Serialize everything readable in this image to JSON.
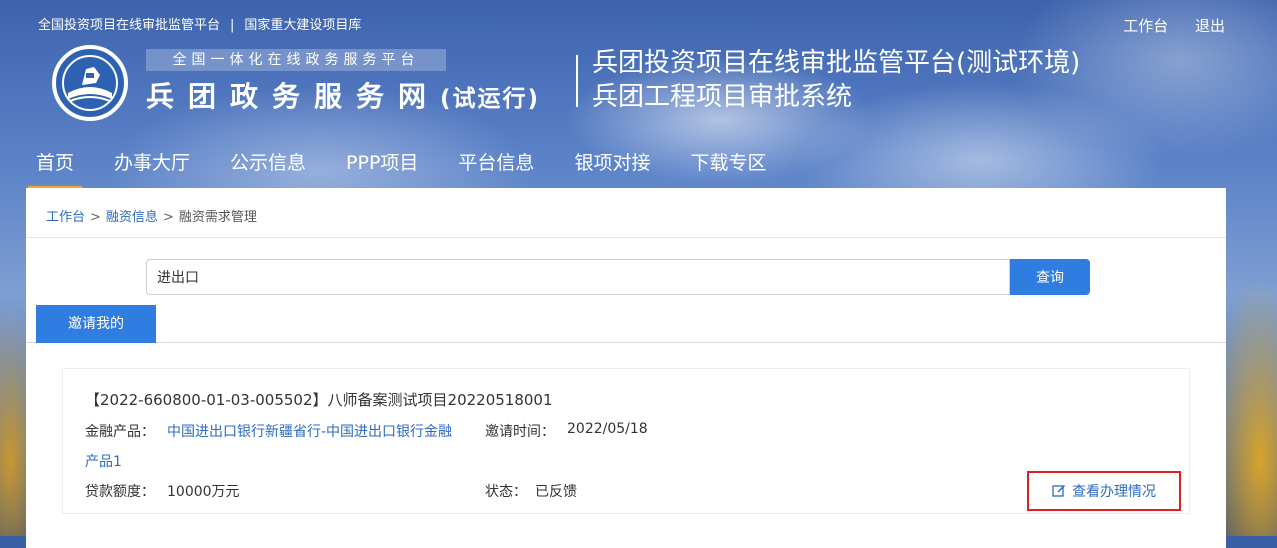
{
  "top_links": {
    "left1": "全国投资项目在线审批监管平台",
    "separator": "|",
    "left2": "国家重大建设项目库",
    "workbench": "工作台",
    "logout": "退出"
  },
  "brand": {
    "subtitle": "全国一体化在线政务服务平台",
    "name": "兵团政务服务网",
    "trial": "(试运行)",
    "platform_line1": "兵团投资项目在线审批监管平台(测试环境)",
    "platform_line2": "兵团工程项目审批系统",
    "emblem_icon": "corps-emblem-icon"
  },
  "nav": {
    "items": [
      "首页",
      "办事大厅",
      "公示信息",
      "PPP项目",
      "平台信息",
      "银项对接",
      "下载专区"
    ],
    "active_color": "#f5a623"
  },
  "breadcrumb": {
    "item1": "工作台",
    "item2": "融资信息",
    "current": "融资需求管理",
    "arrow": ">"
  },
  "search": {
    "value": "进出口",
    "button": "查询"
  },
  "tabs": {
    "active": "邀请我的"
  },
  "card": {
    "title": "【2022-660800-01-03-005502】八师备案测试项目20220518001",
    "product_label": "金融产品：",
    "product_value_line1": "中国进出口银行新疆省行-中国进出口银行金融",
    "product_value_line2": "产品1",
    "invite_time_label": "邀请时间：",
    "invite_time_value": "2022/05/18",
    "loan_label": "贷款额度：",
    "loan_value": "10000万元",
    "status_label": "状态：",
    "status_value": "已反馈",
    "view_button": "查看办理情况",
    "view_icon": "edit-icon"
  },
  "colors": {
    "primary": "#2f7de1",
    "link": "#2d6bc4",
    "highlight_border": "#e02020"
  }
}
